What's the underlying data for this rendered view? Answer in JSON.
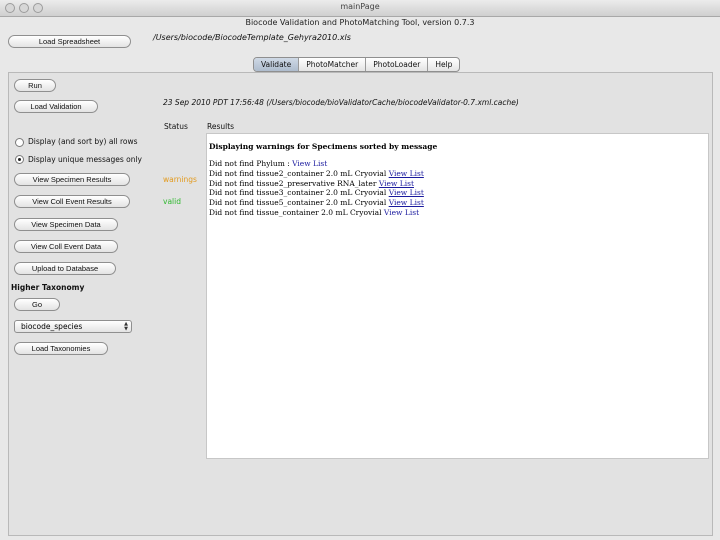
{
  "window": {
    "title": "mainPage"
  },
  "app": {
    "title": "Biocode Validation and PhotoMatching Tool, version 0.7.3"
  },
  "header": {
    "load_spreadsheet": "Load Spreadsheet",
    "spreadsheet_path": "/Users/biocode/BiocodeTemplate_Gehyra2010.xls"
  },
  "tabs": [
    {
      "label": "Validate",
      "active": true
    },
    {
      "label": "PhotoMatcher",
      "active": false
    },
    {
      "label": "PhotoLoader",
      "active": false
    },
    {
      "label": "Help",
      "active": false
    }
  ],
  "validate": {
    "run": "Run",
    "load_validation": "Load Validation",
    "timestamp_path": "23 Sep 2010 PDT 17:56:48 (/Users/biocode/bioValidatorCache/biocodeValidator-0.7.xml.cache)",
    "status_header": "Status",
    "results_header": "Results",
    "radio_all": "Display (and sort by) all rows",
    "radio_unique": "Display unique messages only",
    "view_specimen_results": "View Specimen Results",
    "view_coll_event_results": "View Coll Event Results",
    "view_specimen_data": "View Specimen Data",
    "view_coll_event_data": "View Coll Event Data",
    "upload_database": "Upload to Database",
    "status_warnings": "warnings",
    "status_valid": "valid",
    "status_warnings_color": "#e39a1e",
    "status_valid_color": "#2fb82f"
  },
  "taxonomy": {
    "header": "Higher Taxonomy",
    "go": "Go",
    "selected": "biocode_species",
    "load_taxonomies": "Load Taxonomies"
  },
  "results": {
    "heading": "Displaying warnings for Specimens sorted by message",
    "lines": [
      {
        "text": "Did not find Phylum : ",
        "link": "View List",
        "underline": false
      },
      {
        "text": "Did not find tissue2_container 2.0 mL Cryovial ",
        "link": "View List",
        "underline": true
      },
      {
        "text": "Did not find tissue2_preservative RNA_later ",
        "link": "View List",
        "underline": true
      },
      {
        "text": "Did not find tissue3_container 2.0 mL Cryovial ",
        "link": "View List",
        "underline": true
      },
      {
        "text": "Did not find tissue5_container 2.0 mL Cryovial ",
        "link": "View List",
        "underline": true
      },
      {
        "text": "Did not find tissue_container 2.0 mL Cryovial ",
        "link": "View List",
        "underline": false
      }
    ]
  }
}
